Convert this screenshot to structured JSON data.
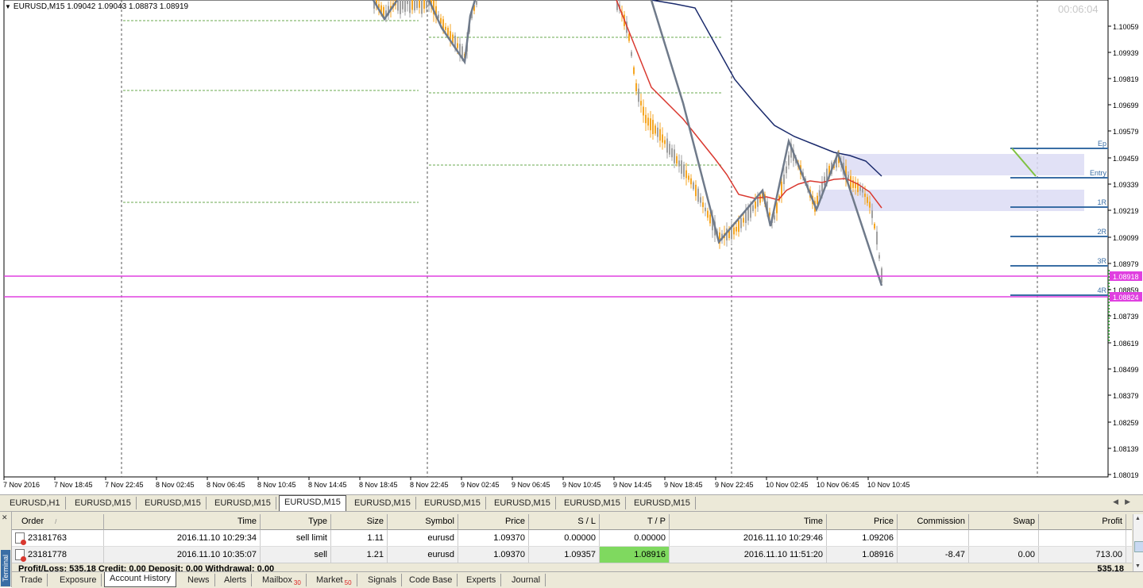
{
  "chart": {
    "symbol_title": "EURUSD,M15  1.09042 1.09043 1.08873 1.08919",
    "timer": "00:06:04",
    "price_levels": [
      "1.10059",
      "1.09939",
      "1.09819",
      "1.09699",
      "1.09579",
      "1.09459",
      "1.09339",
      "1.09219",
      "1.09099",
      "1.08979",
      "1.08859",
      "1.08739",
      "1.08619",
      "1.08499",
      "1.08379",
      "1.08259",
      "1.08139",
      "1.08019"
    ],
    "highlight_prices": [
      "1.08918",
      "1.08824"
    ],
    "time_labels": [
      "7 Nov 2016",
      "7 Nov 18:45",
      "7 Nov 22:45",
      "8 Nov 02:45",
      "8 Nov 06:45",
      "8 Nov 10:45",
      "8 Nov 14:45",
      "8 Nov 18:45",
      "8 Nov 22:45",
      "9 Nov 02:45",
      "9 Nov 06:45",
      "9 Nov 10:45",
      "9 Nov 14:45",
      "9 Nov 18:45",
      "9 Nov 22:45",
      "10 Nov 02:45",
      "10 Nov 06:45",
      "10 Nov 10:45"
    ],
    "level_labels": [
      "Ep",
      "Entry",
      "1R",
      "2R",
      "3R",
      "4R"
    ],
    "colors": {
      "bull": "#f5a623",
      "bear": "#a0a0a0",
      "ma_fast": "#d9382f",
      "ma_slow": "#1a2a6c",
      "zigzag": "#6f7a8a",
      "hline": "#e040e0",
      "level": "#3a6ea5",
      "zone": "#dcdcf5",
      "fib": "#7fc242"
    }
  },
  "chart_tabs": [
    "EURUSD,H1",
    "EURUSD,M15",
    "EURUSD,M15",
    "EURUSD,M15",
    "EURUSD,M15",
    "EURUSD,M15",
    "EURUSD,M15",
    "EURUSD,M15",
    "EURUSD,M15",
    "EURUSD,M15"
  ],
  "terminal": {
    "side_label": "Terminal",
    "headers": [
      "Order",
      "Time",
      "Type",
      "Size",
      "Symbol",
      "Price",
      "S / L",
      "T / P",
      "Time",
      "Price",
      "Commission",
      "Swap",
      "Profit"
    ],
    "rows": [
      [
        "23181763",
        "2016.11.10 10:29:34",
        "sell limit",
        "1.11",
        "eurusd",
        "1.09370",
        "0.00000",
        "0.00000",
        "2016.11.10 10:29:46",
        "1.09206",
        "",
        "",
        ""
      ],
      [
        "23181778",
        "2016.11.10 10:35:07",
        "sell",
        "1.21",
        "eurusd",
        "1.09370",
        "1.09357",
        "1.08916",
        "2016.11.10 11:51:20",
        "1.08916",
        "-8.47",
        "0.00",
        "713.00"
      ]
    ],
    "summary": "Profit/Loss: 535.18  Credit: 0.00  Deposit: 0.00  Withdrawal: 0.00",
    "summary_value": "535.18",
    "tabs": [
      "Trade",
      "Exposure",
      "Account History",
      "News",
      "Alerts",
      "Mailbox",
      "Market",
      "Signals",
      "Code Base",
      "Experts",
      "Journal"
    ],
    "mailbox_badge": "30",
    "market_badge": "50"
  }
}
